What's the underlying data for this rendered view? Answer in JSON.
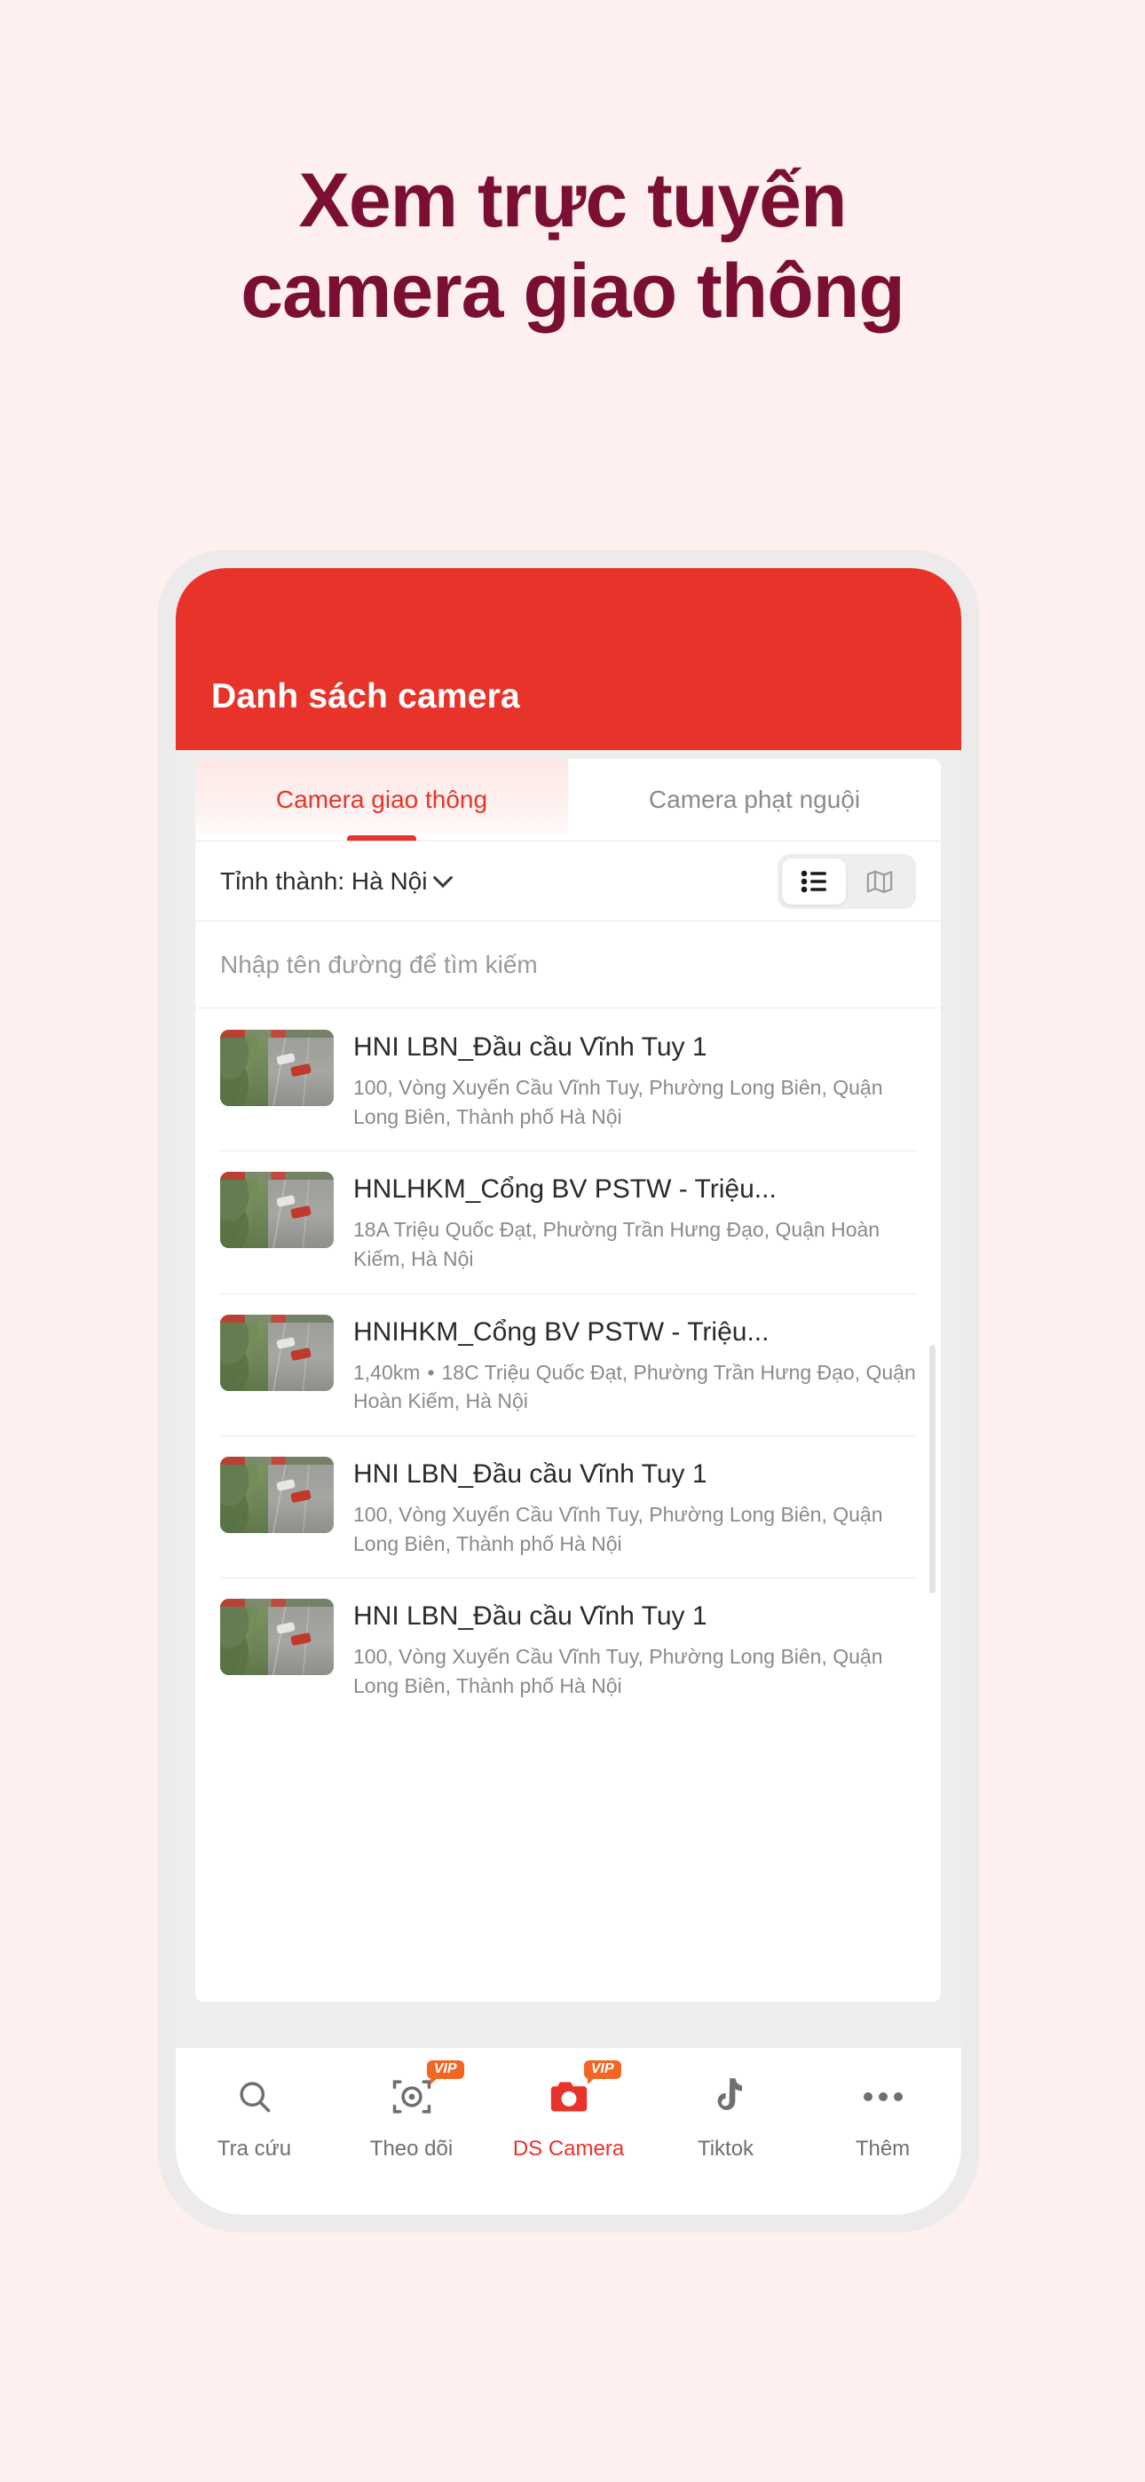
{
  "headline": {
    "line1": "Xem trực tuyến",
    "line2": "camera giao thông",
    "color": "#7a0f33"
  },
  "background_color": "#fdf0ee",
  "app": {
    "header": {
      "title": "Danh sách camera",
      "background": "#e8332a"
    },
    "tabs": [
      {
        "label": "Camera giao thông",
        "active": true
      },
      {
        "label": "Camera phạt nguội",
        "active": false
      }
    ],
    "filter": {
      "province_label": "Tỉnh thành: Hà Nội",
      "chevron_icon": "chevron-down-icon",
      "view_modes": [
        {
          "icon": "list-view-icon",
          "active": true
        },
        {
          "icon": "map-view-icon",
          "active": false
        }
      ]
    },
    "search": {
      "placeholder": "Nhập tên đường để tìm kiếm",
      "value": ""
    },
    "cameras": [
      {
        "title": "HNI LBN_Đầu cầu Vĩnh Tuy 1",
        "distance": "",
        "address": "100, Vòng Xuyến Cầu Vĩnh Tuy, Phường Long Biên, Quận Long Biên, Thành phố Hà Nội"
      },
      {
        "title": "HNLHKM_Cổng BV PSTW - Triệu...",
        "distance": "",
        "address": "18A Triệu Quốc Đạt, Phường Trần Hưng Đạo, Quận Hoàn Kiếm, Hà Nội"
      },
      {
        "title": "HNIHKM_Cổng BV PSTW - Triệu...",
        "distance": "1,40km",
        "address": "18C Triệu Quốc Đạt, Phường Trần Hưng Đạo, Quận Hoàn Kiếm, Hà Nội"
      },
      {
        "title": "HNI LBN_Đầu cầu Vĩnh Tuy 1",
        "distance": "",
        "address": "100, Vòng Xuyến Cầu Vĩnh Tuy, Phường Long Biên, Quận Long Biên, Thành phố Hà Nội"
      },
      {
        "title": "HNI LBN_Đầu cầu Vĩnh Tuy 1",
        "distance": "",
        "address": "100, Vòng Xuyến Cầu Vĩnh Tuy, Phường Long Biên, Quận Long Biên, Thành phố Hà Nội"
      }
    ],
    "bottom_nav": [
      {
        "label": "Tra cứu",
        "icon": "search-icon",
        "active": false,
        "vip": null
      },
      {
        "label": "Theo dõi",
        "icon": "camera-scan-icon",
        "active": false,
        "vip": "VIP"
      },
      {
        "label": "DS Camera",
        "icon": "camera-icon",
        "active": true,
        "vip": "VIP"
      },
      {
        "label": "Tiktok",
        "icon": "tiktok-icon",
        "active": false,
        "vip": null
      },
      {
        "label": "Thêm",
        "icon": "more-dots-icon",
        "active": false,
        "vip": null
      }
    ],
    "accent_color": "#e8332a",
    "vip_badge_color": "#f26522"
  }
}
